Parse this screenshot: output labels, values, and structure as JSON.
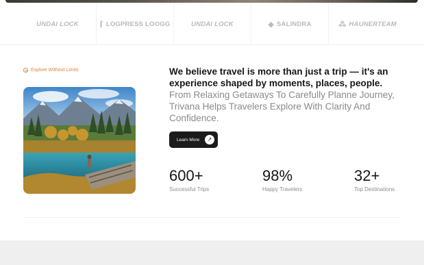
{
  "logos": [
    {
      "name": "UNDAI LOCK",
      "glyph": ""
    },
    {
      "name": "LOGPRESS LOOGG",
      "glyph": "⌈"
    },
    {
      "name": "UNDAI LOCK",
      "glyph": ""
    },
    {
      "name": "SALINDRA",
      "glyph": "◆"
    },
    {
      "name": "HAUNERTEAM",
      "glyph": "⁂"
    }
  ],
  "about": {
    "tag": "Explore Without Limits",
    "headline": "We believe travel is more than just a trip — it's an experience shaped by moments, places, people.",
    "subline": "From Relaxing Getaways To Carefully Planne Journey, Trivana Helps Travelers Explore With Clarity And Confidence.",
    "button_label": "Learn More",
    "button_icon": "arrow-up-right-icon"
  },
  "stats": [
    {
      "value": "600+",
      "label": "Successful Trips"
    },
    {
      "value": "98%",
      "label": "Happy Travelers"
    },
    {
      "value": "32+",
      "label": "Top Destinations"
    }
  ],
  "colors": {
    "accent": "#e0843a",
    "button_bg": "#1b1b1b",
    "muted_text": "#8a8a8a",
    "footer_band": "#efefef"
  }
}
